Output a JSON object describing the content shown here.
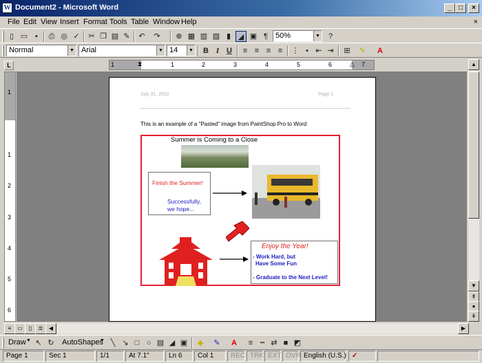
{
  "window": {
    "title": "Document2 - Microsoft Word",
    "app_icon": "word-icon",
    "min": "_",
    "max": "□",
    "close": "×",
    "doc_close": "×"
  },
  "menu": [
    "File",
    "Edit",
    "View",
    "Insert",
    "Format",
    "Tools",
    "Table",
    "Window",
    "Help"
  ],
  "standard_toolbar": {
    "zoom": "50%"
  },
  "format_toolbar": {
    "style": "Normal",
    "font": "Arial",
    "size": "14",
    "bold": "B",
    "italic": "I",
    "underline": "U"
  },
  "ruler": {
    "tab_marker": "L",
    "numbers": [
      "1",
      "1",
      "2",
      "3",
      "4",
      "5",
      "6",
      "7"
    ],
    "v_numbers": [
      "1",
      "1",
      "2",
      "3",
      "4",
      "5",
      "6"
    ]
  },
  "document": {
    "header_left": "July 31, 2002",
    "header_right": "Page 1",
    "body_text": "This is an example of a \"Pasted\" image from PaintShop Pro to Word",
    "image": {
      "title": "Summer is Coming to a Close",
      "finish": "Finish the Summer!",
      "success": "Successfully,",
      "hope": "we hope...",
      "enjoy": "Enjoy the Year!",
      "work": "- Work Hard, but",
      "fun": "Have Some Fun",
      "grad": "- Graduate to the Next Level!"
    }
  },
  "draw_toolbar": {
    "draw": "Draw",
    "autoshapes": "AutoShapes"
  },
  "status": {
    "page": "Page 1",
    "sec": "Sec 1",
    "pages": "1/1",
    "at": "At 7.1\"",
    "ln": "Ln 6",
    "col": "Col 1",
    "rec": "REC",
    "trk": "TRK",
    "ext": "EXT",
    "ovr": "OVR",
    "lang": "English (U.S.)"
  }
}
